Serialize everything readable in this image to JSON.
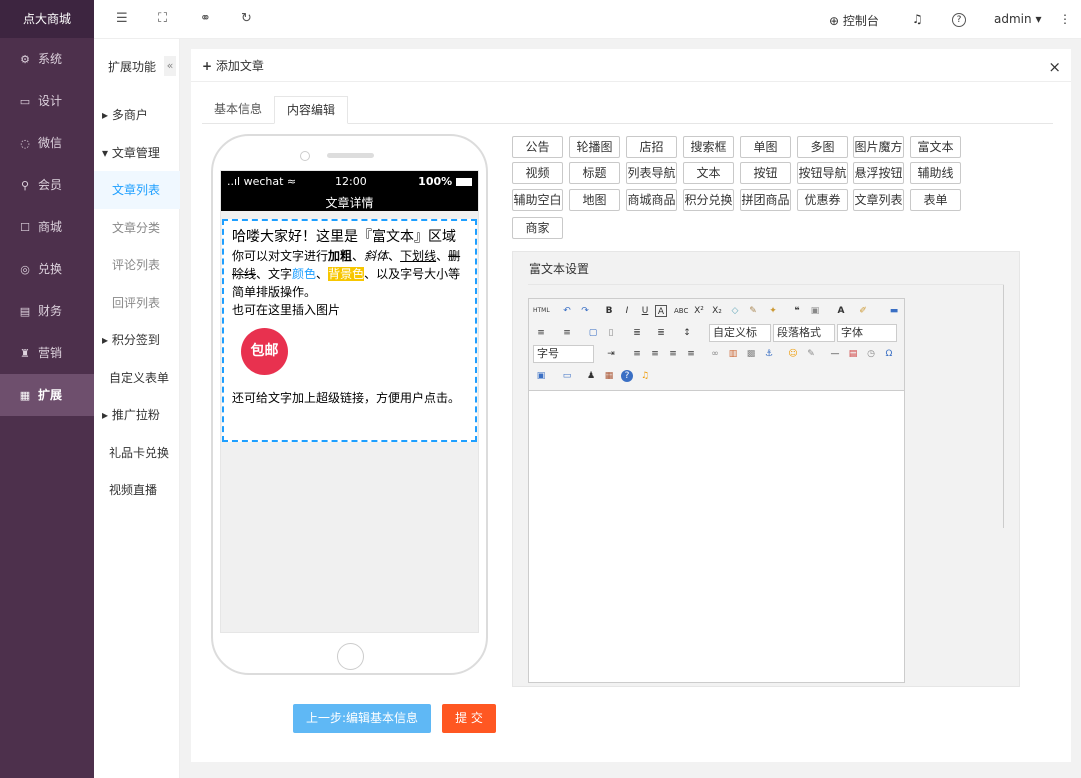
{
  "brand": "点大商城",
  "left_nav": [
    {
      "label": "系统",
      "icon": "gear-icon",
      "glyph": "⚙"
    },
    {
      "label": "设计",
      "icon": "monitor-icon",
      "glyph": "▭"
    },
    {
      "label": "微信",
      "icon": "wechat-icon",
      "glyph": "◌"
    },
    {
      "label": "会员",
      "icon": "user-icon",
      "glyph": "⚲"
    },
    {
      "label": "商城",
      "icon": "store-icon",
      "glyph": "☐"
    },
    {
      "label": "兑换",
      "icon": "exchange-icon",
      "glyph": "◎"
    },
    {
      "label": "财务",
      "icon": "finance-icon",
      "glyph": "▤"
    },
    {
      "label": "营销",
      "icon": "marketing-icon",
      "glyph": "♜"
    },
    {
      "label": "扩展",
      "icon": "grid-icon",
      "glyph": "▦"
    }
  ],
  "sub_nav": {
    "title": "扩展功能",
    "collapse": "«",
    "items": [
      {
        "label": "多商户",
        "type": "group",
        "arrow": "▸"
      },
      {
        "label": "文章管理",
        "type": "group",
        "arrow": "▾"
      },
      {
        "label": "文章列表",
        "type": "child"
      },
      {
        "label": "文章分类",
        "type": "child"
      },
      {
        "label": "评论列表",
        "type": "child"
      },
      {
        "label": "回评列表",
        "type": "child"
      },
      {
        "label": "积分签到",
        "type": "group",
        "arrow": "▸"
      },
      {
        "label": "自定义表单",
        "type": "plain"
      },
      {
        "label": "推广拉粉",
        "type": "group",
        "arrow": "▸"
      },
      {
        "label": "礼品卡兑换",
        "type": "plain"
      },
      {
        "label": "视频直播",
        "type": "plain"
      }
    ]
  },
  "topbar": {
    "control_label": "控制台",
    "user": "admin",
    "icons": {
      "menu": "☰",
      "fullscreen": "⛶",
      "link": "⚭",
      "refresh": "↻",
      "globe": "⊕",
      "bell": "♫",
      "help": "?",
      "more": "⋮",
      "caret": "▾"
    }
  },
  "panel": {
    "title": "添加文章",
    "title_icon": "+",
    "close": "×",
    "tabs": [
      "基本信息",
      "内容编辑"
    ]
  },
  "phone": {
    "signal": "..ıl wechat ≈",
    "time": "12:00",
    "battery": "100%",
    "page_title": "文章详情",
    "heading": "哈喽大家好！这里是『富文本』区域",
    "line1_a": "你可以对文字进行",
    "bold": "加粗",
    "sep1": "、",
    "italic": "斜体",
    "sep2": "、",
    "underline": "下划线",
    "sep3": "、",
    "strike": "删除线",
    "sep4": "、文字",
    "color_text": "颜色",
    "sep5": "、",
    "bg_text": "背景色",
    "line1_end": "、以及字号大小等简单排版操作。",
    "line2": "也可在这里插入图片",
    "badge": "包邮",
    "line3": "还可给文字加上超级链接，方便用户点击。"
  },
  "widgets": [
    "公告",
    "轮播图",
    "店招",
    "搜索框",
    "单图",
    "多图",
    "图片魔方",
    "富文本",
    "视频",
    "标题",
    "列表导航",
    "文本",
    "按钮",
    "按钮导航",
    "悬浮按钮",
    "辅助线",
    "辅助空白",
    "地图",
    "商城商品",
    "积分兑换",
    "拼团商品",
    "优惠券",
    "文章列表",
    "表单",
    "商家"
  ],
  "rich_text": {
    "title": "富文本设置",
    "selects": [
      "自定义标",
      "段落格式",
      "字体",
      "字号"
    ]
  },
  "buttons": {
    "prev": "上一步:编辑基本信息",
    "submit": "提 交",
    "prev_color": "#5fb8f5",
    "submit_color": "#ff5722"
  }
}
